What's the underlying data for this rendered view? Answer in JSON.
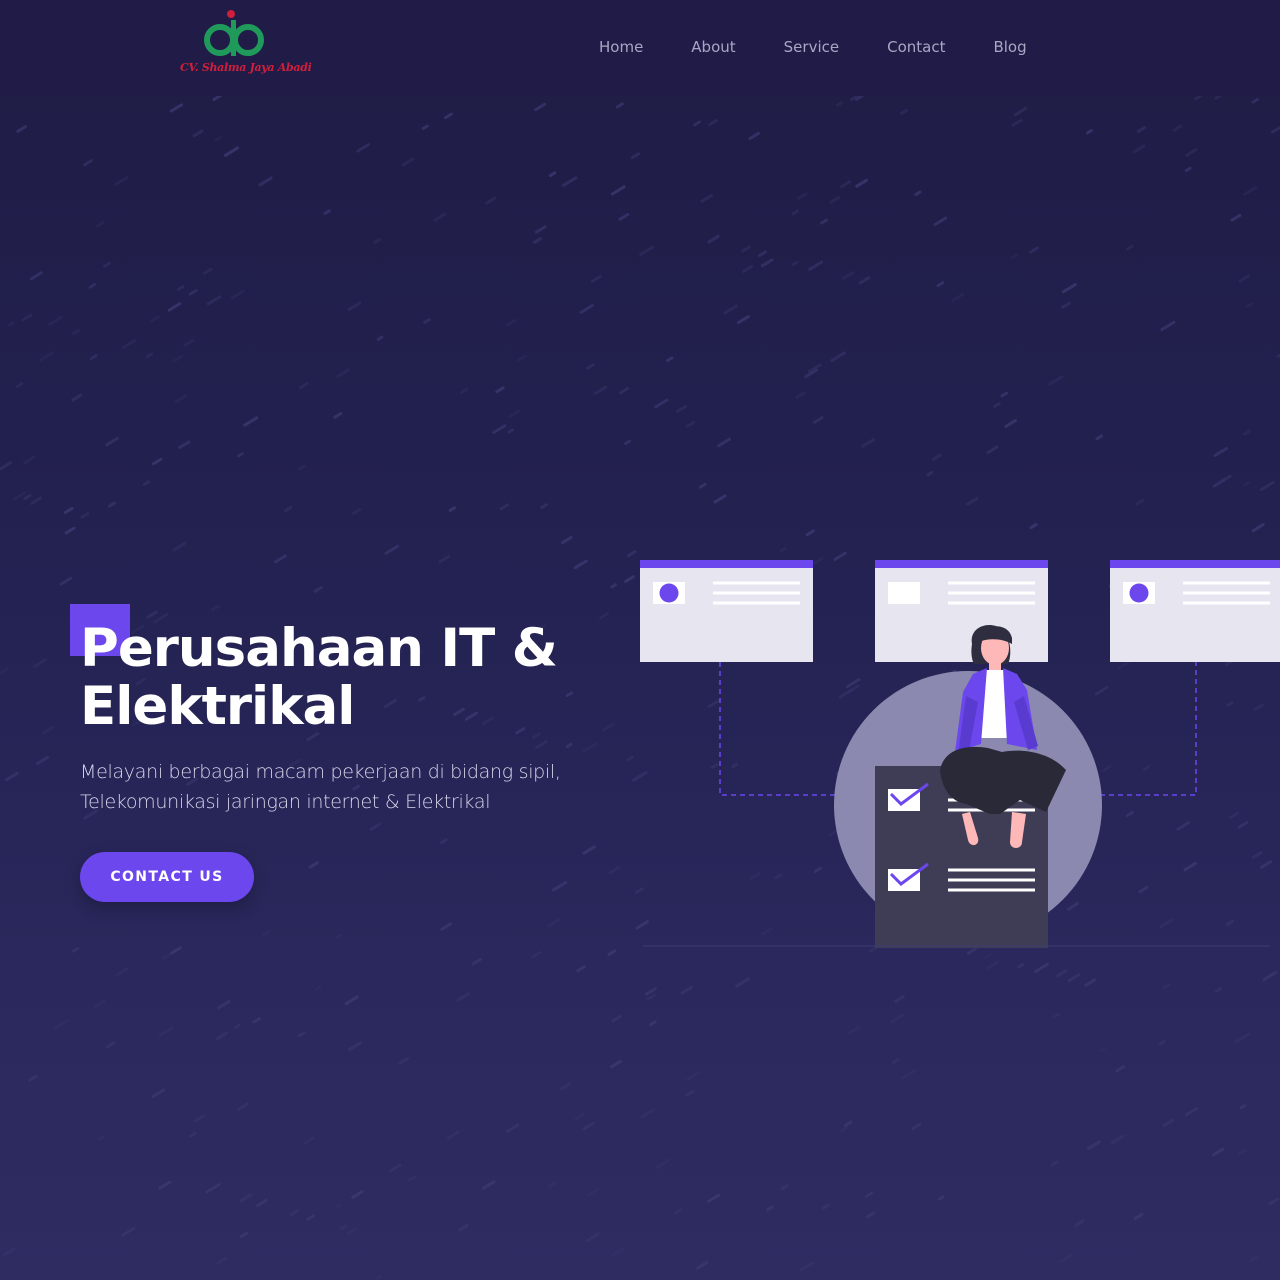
{
  "header": {
    "logo_text": "CV. Shalma Jaya Abadi",
    "nav": [
      {
        "label": "Home"
      },
      {
        "label": "About"
      },
      {
        "label": "Service"
      },
      {
        "label": "Contact"
      },
      {
        "label": "Blog"
      }
    ]
  },
  "hero": {
    "title": "Perusahaan IT & Elektrikal",
    "subtitle": "Melayani berbagai macam pekerjaan di bidang sipil, Telekomunikasi jaringan internet & Elektrikal",
    "cta_label": "CONTACT US"
  },
  "colors": {
    "accent": "#6c47ee",
    "background": "#221f4b",
    "logo_green": "#1f9a5a",
    "logo_red": "#d01f3c"
  },
  "icons": [
    "logo-mark",
    "checkmark-icon",
    "avatar-dot-icon"
  ]
}
